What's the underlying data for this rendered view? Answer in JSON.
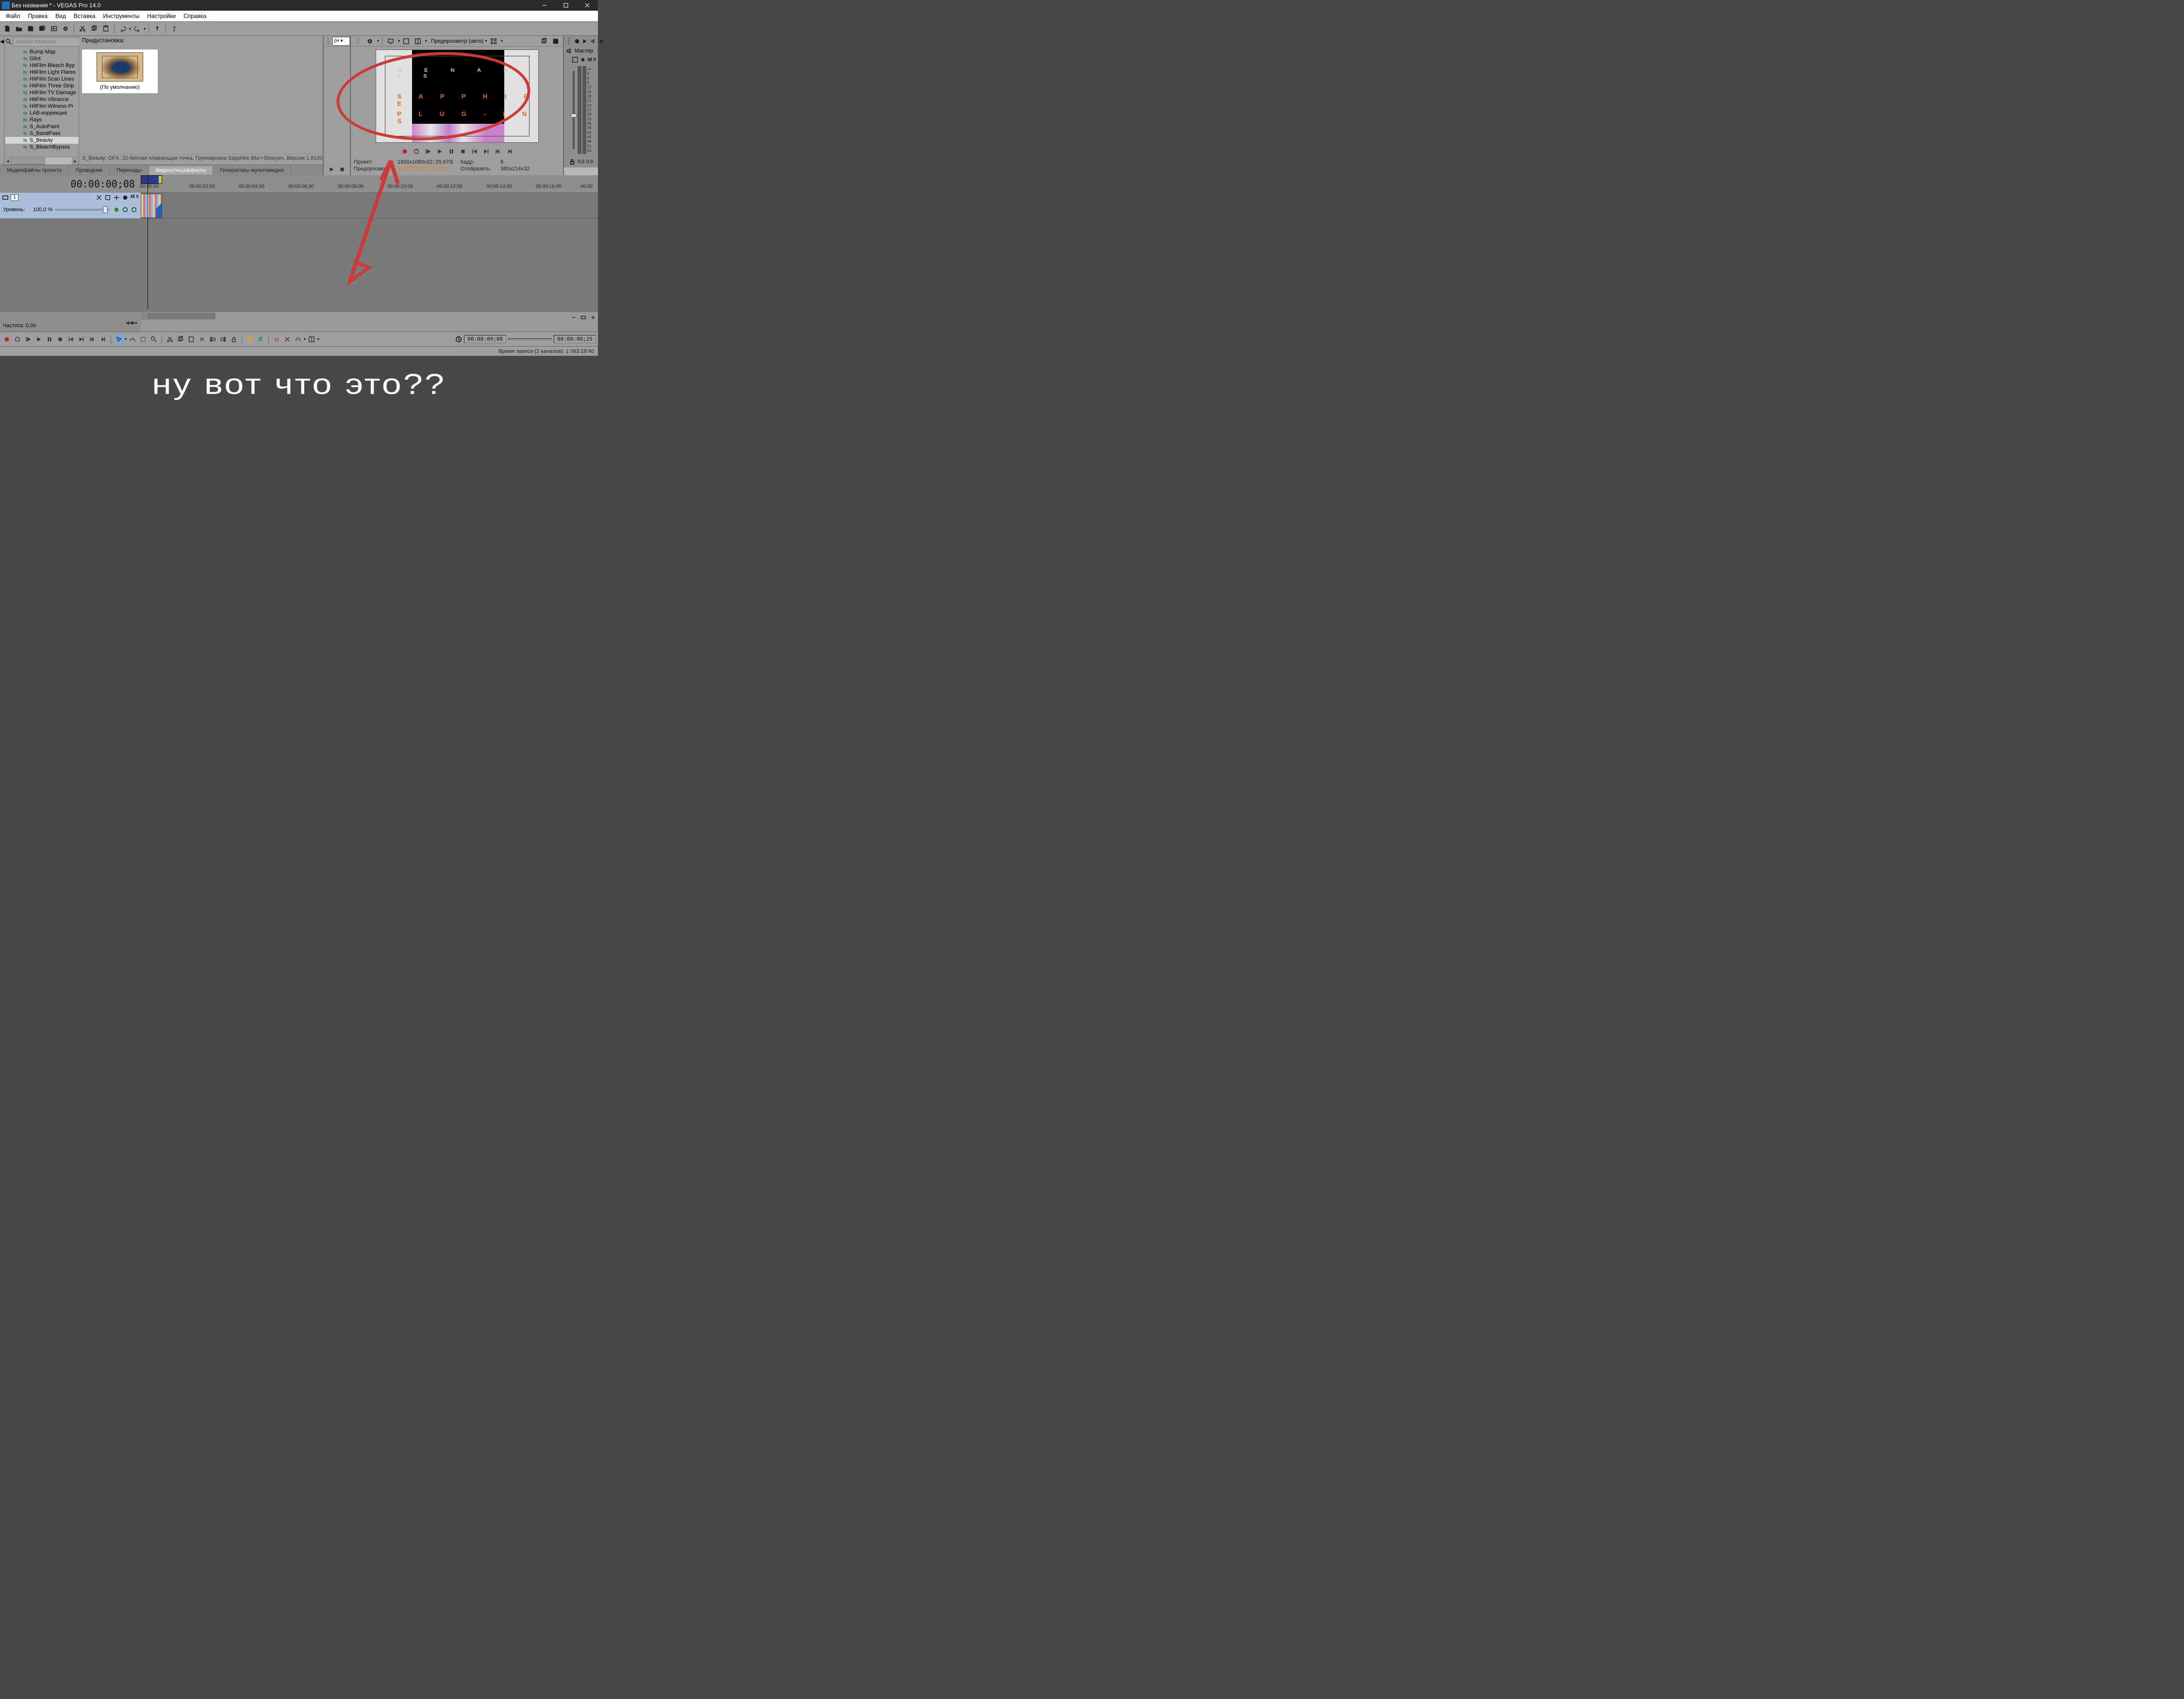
{
  "window": {
    "title": "Без названия * - VEGAS Pro 14.0"
  },
  "menu": [
    "Файл",
    "Правка",
    "Вид",
    "Вставка",
    "Инструменты",
    "Настройки",
    "Справка"
  ],
  "plugin_search_placeholder": "Найти плагины",
  "plugin_tree": [
    {
      "label": "Bump Map",
      "style": "b"
    },
    {
      "label": "Glint",
      "style": "b"
    },
    {
      "label": "HitFilm Bleach Byp",
      "style": "g"
    },
    {
      "label": "HitFilm Light Flares",
      "style": "g"
    },
    {
      "label": "HitFilm Scan Lines",
      "style": "g"
    },
    {
      "label": "HitFilm Three Strip",
      "style": "g"
    },
    {
      "label": "HitFilm TV Damage",
      "style": "g"
    },
    {
      "label": "HitFilm Vibrance",
      "style": "g"
    },
    {
      "label": "HitFilm Witness Pr",
      "style": "g"
    },
    {
      "label": "LAB-коррекция",
      "style": "b"
    },
    {
      "label": "Rays",
      "style": "b"
    },
    {
      "label": "S_AutoPaint",
      "style": "b"
    },
    {
      "label": "S_BandPass",
      "style": "b"
    },
    {
      "label": "S_Beauty",
      "style": "b",
      "selected": true
    },
    {
      "label": "S_BleachBypass",
      "style": "b"
    }
  ],
  "preset": {
    "heading": "Предустановка:",
    "item_label": "(По умолчанию)",
    "status": "S_Beauty: OFX, 32-битная плавающая точка,  Группировка  Sapphire Blur+Sharpen, Версия 1.8100"
  },
  "tabs": [
    "Медиафайлы проекта",
    "Проводник",
    "Переходы",
    "Видеоспецэффекты",
    "Генераторы мультимедиа"
  ],
  "tabs_active_index": 3,
  "trimmer_dropdown": "(Н ▾",
  "preview": {
    "quality_label": "Предпросмотр (авто)",
    "text_line1": "G E N A R T S",
    "text_line2": "S A P P H I R E",
    "text_line3": "P L U G - I N S",
    "info": {
      "project_k": "Проект:",
      "project_v": "1920x1080x32; 29,970i",
      "frame_k": "Кадр:",
      "frame_v": "8",
      "preview_k": "Предпросмотр:",
      "preview_v": "480x270x32; 29,970p",
      "display_k": "Отобразить:",
      "display_v": "380x214x32"
    }
  },
  "mixer": {
    "label": "Мастер",
    "scale": [
      "-∞",
      "3",
      "6",
      "9",
      "12",
      "15",
      "18",
      "21",
      "24",
      "27",
      "30",
      "33",
      "36",
      "39",
      "42",
      "45",
      "48",
      "51",
      "54"
    ],
    "readout": "0,0"
  },
  "timeline": {
    "timecode": "00:00:00;08",
    "ruler": [
      "00:00:00",
      "00:00:02;00",
      "00:00:04;00",
      "00:00:06;00",
      "00:00:08;00",
      "00:00:10;00",
      "00:00:12;00",
      "00:00:14;00",
      "00:00:16;00",
      "00:00"
    ],
    "track_number": "1",
    "level_label": "Уровень:",
    "level_value": "100,0 %",
    "rate_label": "Частота: 0,00"
  },
  "transport_timecodes": [
    "00:00:00;08",
    "00:00:00;25"
  ],
  "status": "Время записи (2 каналов):  1 063:18:40",
  "caption": "ну вот что это??",
  "letters": {
    "m": "M",
    "s": "S"
  }
}
